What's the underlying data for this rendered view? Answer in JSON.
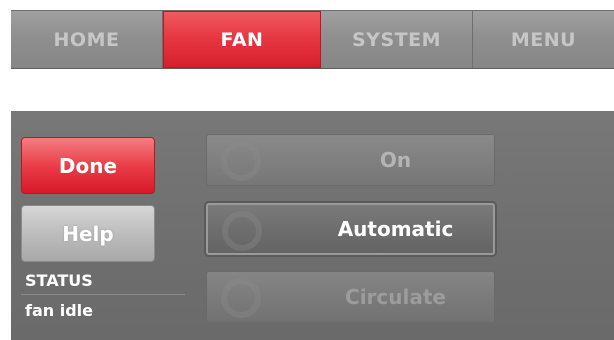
{
  "tabs": [
    {
      "label": "HOME",
      "active": false
    },
    {
      "label": "FAN",
      "active": true
    },
    {
      "label": "SYSTEM",
      "active": false
    },
    {
      "label": "MENU",
      "active": false
    }
  ],
  "actions": {
    "done_label": "Done",
    "help_label": "Help"
  },
  "status": {
    "label": "STATUS",
    "value": "fan idle"
  },
  "fan_options": [
    {
      "label": "On",
      "selected": false
    },
    {
      "label": "Automatic",
      "selected": true
    },
    {
      "label": "Circulate",
      "selected": false
    }
  ],
  "colors": {
    "accent_red": "#e63843",
    "panel_gray": "#6e6e6e"
  }
}
